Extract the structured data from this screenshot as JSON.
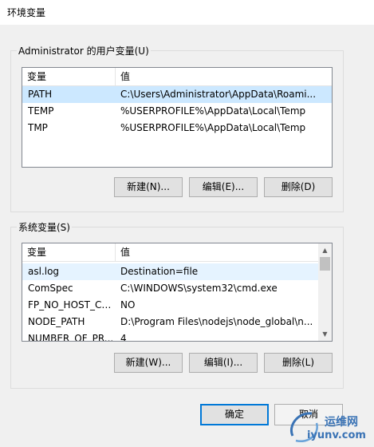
{
  "window": {
    "title": "环境变量"
  },
  "user_vars": {
    "group_label": "Administrator 的用户变量(U)",
    "columns": [
      "变量",
      "值"
    ],
    "rows": [
      {
        "name": "PATH",
        "value": "C:\\Users\\Administrator\\AppData\\Roami..."
      },
      {
        "name": "TEMP",
        "value": "%USERPROFILE%\\AppData\\Local\\Temp"
      },
      {
        "name": "TMP",
        "value": "%USERPROFILE%\\AppData\\Local\\Temp"
      }
    ],
    "buttons": {
      "new": "新建(N)...",
      "edit": "编辑(E)...",
      "delete": "删除(D)"
    }
  },
  "system_vars": {
    "group_label": "系统变量(S)",
    "columns": [
      "变量",
      "值"
    ],
    "rows": [
      {
        "name": "asl.log",
        "value": "Destination=file"
      },
      {
        "name": "ComSpec",
        "value": "C:\\WINDOWS\\system32\\cmd.exe"
      },
      {
        "name": "FP_NO_HOST_CH...",
        "value": "NO"
      },
      {
        "name": "NODE_PATH",
        "value": "D:\\Program Files\\nodejs\\node_global\\n..."
      },
      {
        "name": "NUMBER_OF_PR...",
        "value": "4"
      }
    ],
    "buttons": {
      "new": "新建(W)...",
      "edit": "编辑(I)...",
      "delete": "删除(L)"
    }
  },
  "dialog_buttons": {
    "ok": "确定",
    "cancel": "取消"
  },
  "watermark": {
    "line1": "运维网",
    "line2": "iyunv.com"
  },
  "colors": {
    "selected_row": "#cce8ff",
    "hover_row": "#e5f3ff",
    "default_button_border": "#0078d7",
    "watermark": "#3a73b5"
  }
}
